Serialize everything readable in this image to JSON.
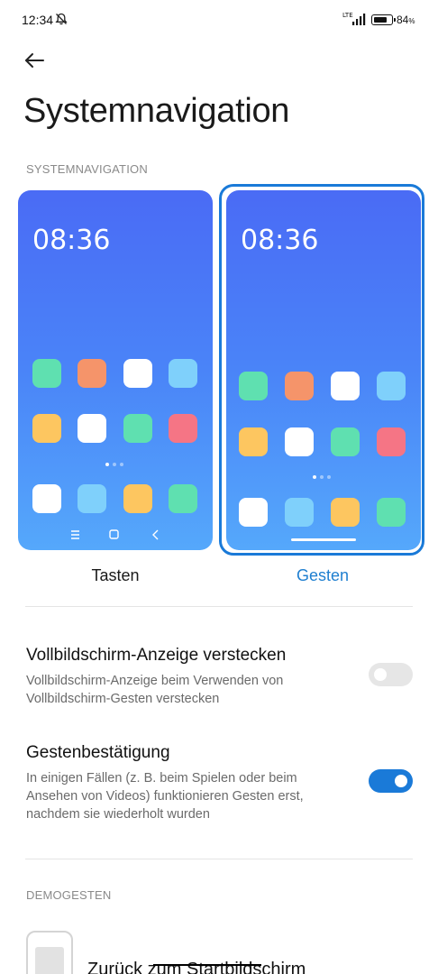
{
  "status_bar": {
    "time": "12:34",
    "network": "LTE",
    "battery_percent_label": "84",
    "battery_unit": "%",
    "battery_level": 0.84,
    "icons": [
      "mute-icon",
      "signal-icon",
      "battery-icon"
    ]
  },
  "header": {
    "back_icon": "arrow-left-icon",
    "title": "Systemnavigation"
  },
  "section_navigation": {
    "heading": "SYSTEMNAVIGATION",
    "options": [
      {
        "label": "Tasten",
        "preview_time": "08:36",
        "selected": false
      },
      {
        "label": "Gesten",
        "preview_time": "08:36",
        "selected": true
      }
    ]
  },
  "settings": [
    {
      "title": "Vollbildschirm-Anzeige verstecken",
      "subtitle": "Vollbildschirm-Anzeige beim Verwenden von Vollbildschirm-Gesten verstecken",
      "enabled": false
    },
    {
      "title": "Gestenbestätigung",
      "subtitle": "In einigen Fällen (z. B. beim Spielen oder beim Ansehen von Videos) funktionieren Gesten erst, nachdem sie wiederholt wurden",
      "enabled": true
    }
  ],
  "section_demo": {
    "heading": "DEMOGESTEN",
    "items": [
      {
        "title": "Zurück zum Startbildschirm"
      }
    ]
  },
  "colors": {
    "accent": "#1a7ad8",
    "preview_gradient_top": "#4a6bf5",
    "preview_gradient_bottom": "#55a8fb",
    "app_green": "#5fe0b0",
    "app_orange": "#f5946a",
    "app_white": "#ffffff",
    "app_lightblue": "#7fd0fb",
    "app_yellow": "#fdc660",
    "app_red": "#f57585"
  }
}
